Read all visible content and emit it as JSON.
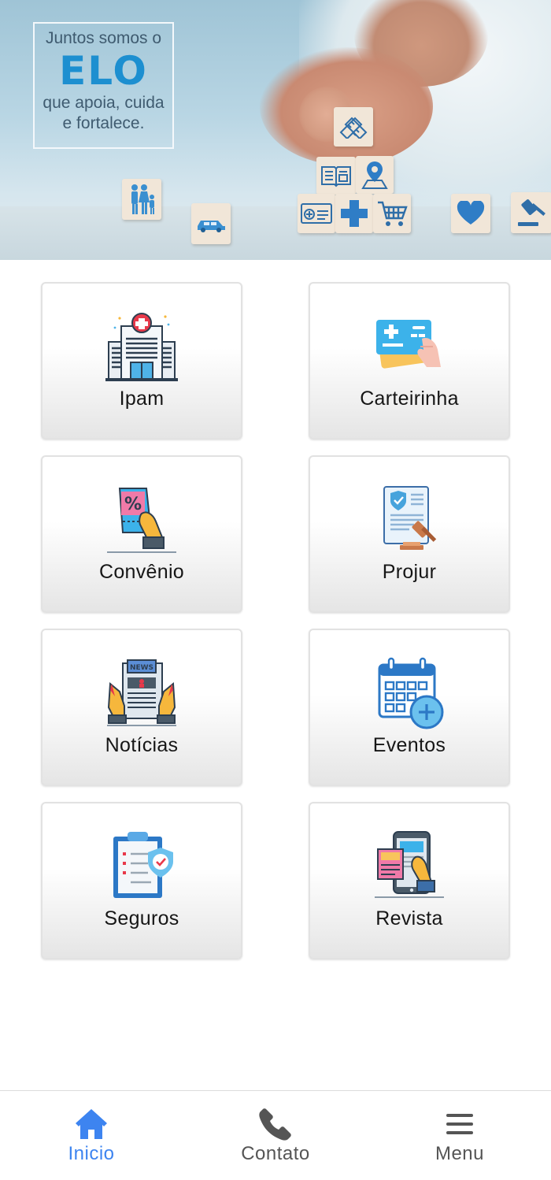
{
  "banner": {
    "slogan_line1": "Juntos somos o",
    "slogan_brand": "ELO",
    "slogan_line2": "que apoia, cuida",
    "slogan_line3": "e fortalece.",
    "brand_color": "#1d8fd0"
  },
  "grid": {
    "items": [
      {
        "label": "Ipam",
        "icon": "hospital-icon"
      },
      {
        "label": "Carteirinha",
        "icon": "health-card-icon"
      },
      {
        "label": "Convênio",
        "icon": "discount-coupon-icon"
      },
      {
        "label": "Projur",
        "icon": "legal-document-gavel-icon"
      },
      {
        "label": "Notícias",
        "icon": "newspaper-icon"
      },
      {
        "label": "Eventos",
        "icon": "calendar-add-icon"
      },
      {
        "label": "Seguros",
        "icon": "insurance-clipboard-shield-icon"
      },
      {
        "label": "Revista",
        "icon": "magazine-tablet-icon"
      }
    ]
  },
  "bottom_nav": {
    "items": [
      {
        "label": "Inicio",
        "icon": "home-icon",
        "active": true
      },
      {
        "label": "Contato",
        "icon": "phone-icon",
        "active": false
      },
      {
        "label": "Menu",
        "icon": "hamburger-menu-icon",
        "active": false
      }
    ],
    "active_color": "#3d84f0",
    "inactive_color": "#555555"
  }
}
